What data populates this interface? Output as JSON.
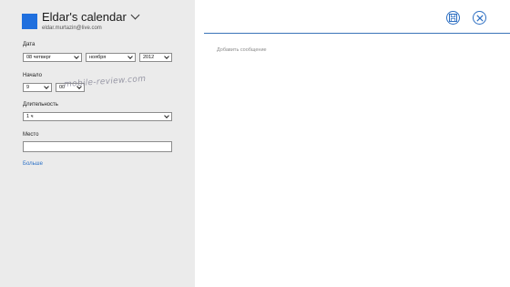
{
  "header": {
    "calendar_name": "Eldar's calendar",
    "email": "eldar.murtazin@live.com",
    "accent": "#1f6fde"
  },
  "form": {
    "date_label": "Дата",
    "day_value": "08 четверг",
    "month_value": "ноября",
    "year_value": "2012",
    "start_label": "Начало",
    "hour_value": "9",
    "minute_value": "00",
    "duration_label": "Длительность",
    "duration_value": "1 ч",
    "location_label": "Место",
    "location_value": "",
    "more_link": "Больше"
  },
  "message": {
    "placeholder": "Добавить сообщение"
  },
  "watermark": "mobile-review.com",
  "toolbar": {
    "save_icon": "save-icon",
    "close_icon": "close-icon"
  }
}
